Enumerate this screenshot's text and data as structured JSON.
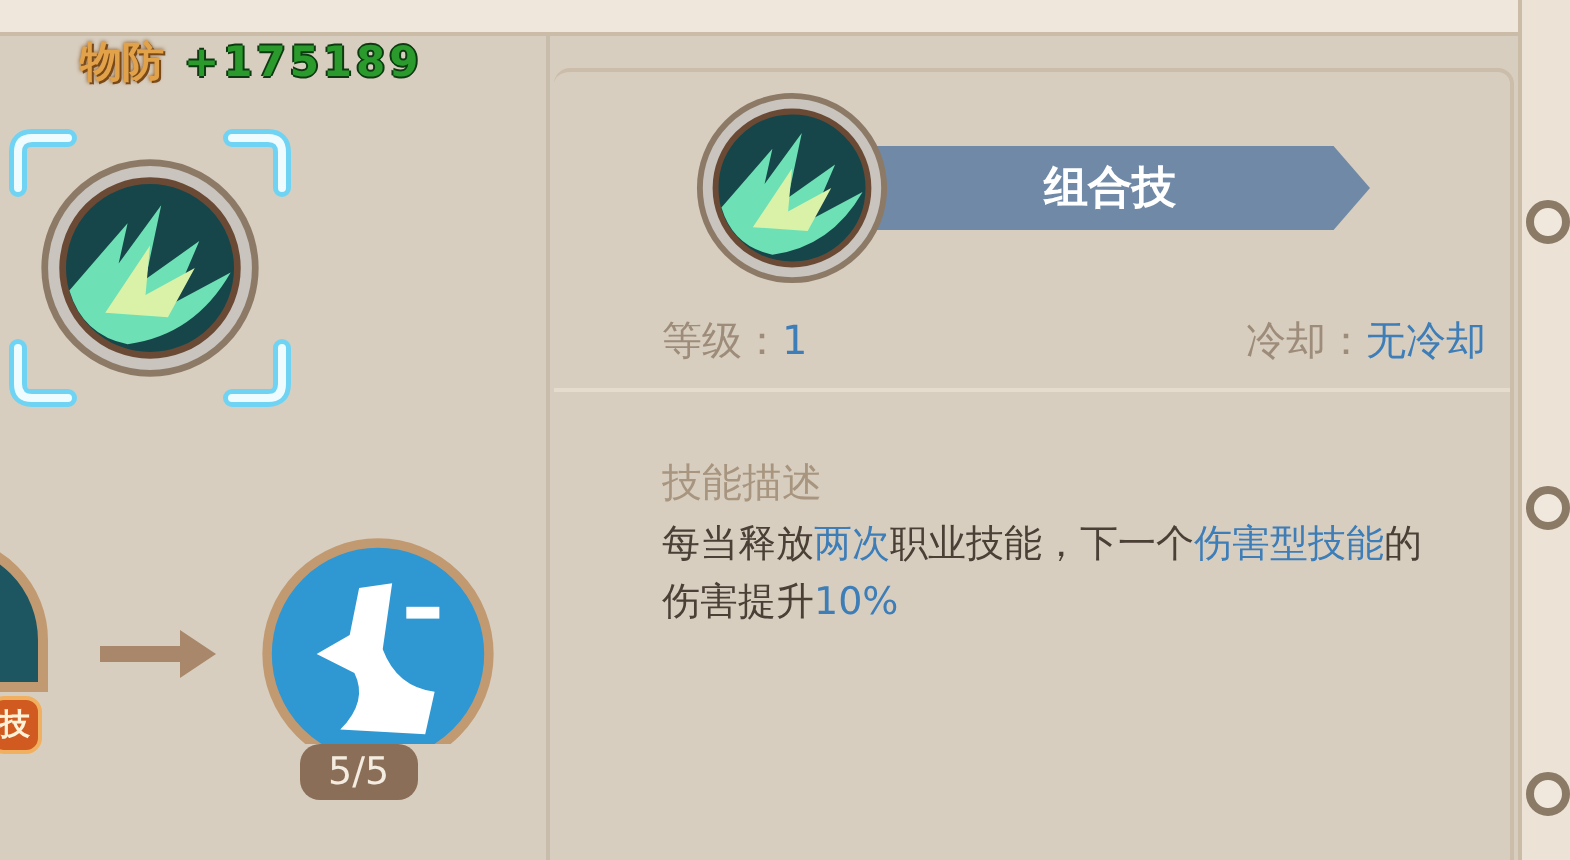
{
  "stat": {
    "label": "物防",
    "value": "+175189"
  },
  "skill_tree": {
    "nodes": [
      {
        "kind": "skill",
        "selected": true
      },
      {
        "kind": "partial",
        "badge": "技"
      },
      {
        "kind": "passive",
        "count": "5/5"
      }
    ]
  },
  "detail": {
    "title": "组合技",
    "level_label": "等级：",
    "level": "1",
    "cooldown_label": "冷却：",
    "cooldown": "无冷却",
    "description_title": "技能描述",
    "description": [
      {
        "text": "每当释放",
        "highlight": false
      },
      {
        "text": "两次",
        "highlight": true
      },
      {
        "text": "职业技能，下一个",
        "highlight": false
      },
      {
        "text": "伤害型技能",
        "highlight": true
      },
      {
        "text": "的伤害提升",
        "highlight": false
      },
      {
        "text": "10%",
        "highlight": true
      }
    ]
  }
}
